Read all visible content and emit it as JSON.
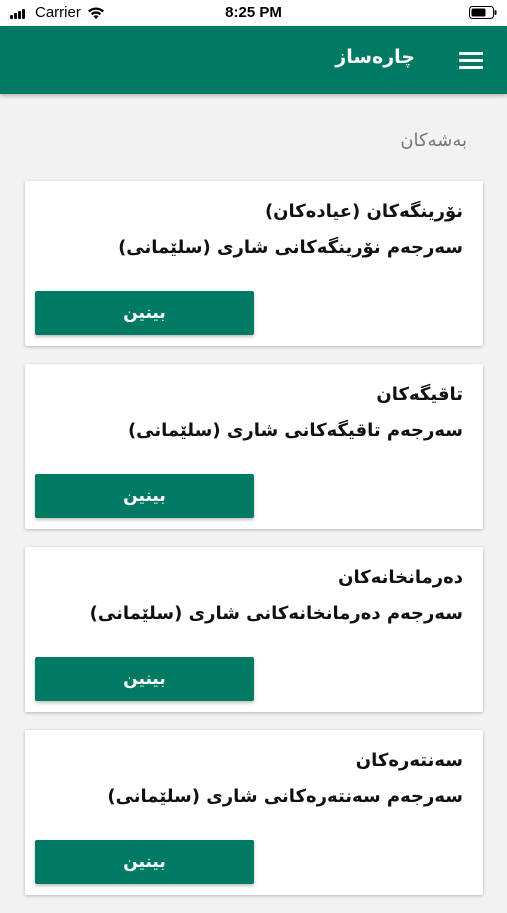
{
  "status_bar": {
    "carrier": "Carrier",
    "time": "8:25 PM"
  },
  "app_bar": {
    "title": "چارەساز",
    "background_color": "#007a63"
  },
  "section": {
    "title": "بەشەکان"
  },
  "cards": [
    {
      "title": "نۆرینگەکان (عیادەکان)",
      "subtitle": "سەرجەم نۆرینگەکانی شاری (سلێمانی)",
      "button_label": "بینین"
    },
    {
      "title": "تاقیگەکان",
      "subtitle": "سەرجەم تاقیگەکانی شاری (سلێمانی)",
      "button_label": "بینین"
    },
    {
      "title": "دەرمانخانەکان",
      "subtitle": "سەرجەم دەرمانخانەکانی شاری (سلێمانی)",
      "button_label": "بینین"
    },
    {
      "title": "سەنتەرەکان",
      "subtitle": "سەرجەم سەنتەرەکانی شاری (سلێمانی)",
      "button_label": "بینین"
    }
  ],
  "icons": {
    "menu": "hamburger-menu-icon",
    "signal": "cellular-signal-icon",
    "wifi": "wifi-icon",
    "battery": "battery-icon"
  },
  "colors": {
    "primary": "#007a63",
    "background": "#f2f2f2",
    "card": "#ffffff"
  }
}
